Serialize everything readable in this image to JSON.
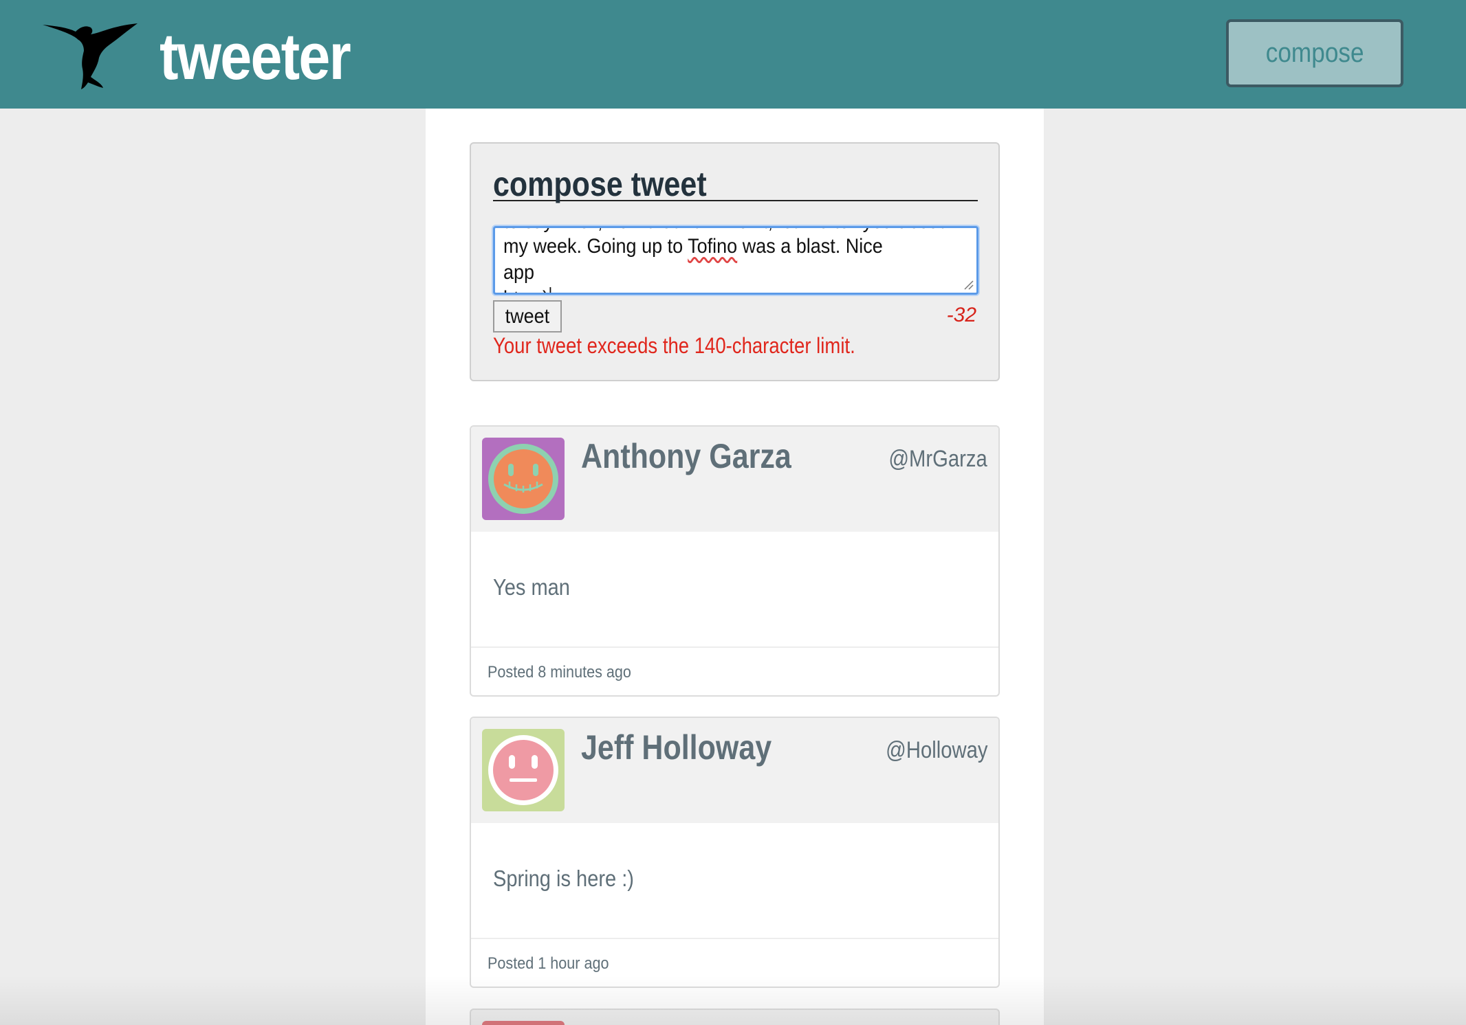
{
  "header": {
    "brand": "tweeter",
    "logo_icon": "hummingbird-icon",
    "compose_label": "compose",
    "bg_color": "#3f898e"
  },
  "composer": {
    "title": "compose tweet",
    "text_overflow_line": "to say. Well, now that I think of it, let me tell you about",
    "text_line_pre": "my week. Going up to ",
    "text_misspelled": "Tofino",
    "text_line_post": " was a blast. Nice app\nbtw :)",
    "submit_label": "tweet",
    "char_counter": "-32",
    "error": "Your tweet exceeds the 140-character limit."
  },
  "tweets": [
    {
      "name": "Anthony Garza",
      "handle": "@MrGarza",
      "content": "Yes man",
      "posted": "Posted 8 minutes ago",
      "avatar_bg": "#b36fbf",
      "avatar_face": "#f08a5a",
      "avatar_ring": "#8ed1b0"
    },
    {
      "name": "Jeff Holloway",
      "handle": "@Holloway",
      "content": "Spring is here :)",
      "posted": "Posted 1 hour ago",
      "avatar_bg": "#c8dc9a",
      "avatar_face": "#ef9aa4",
      "avatar_ring": "#ffffff"
    }
  ]
}
